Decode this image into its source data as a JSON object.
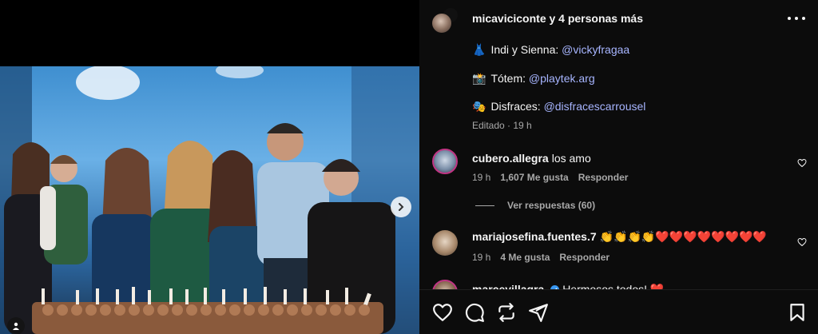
{
  "header": {
    "title": "micaviciconte y 4 personas más",
    "more_icon": "more-horizontal-icon"
  },
  "caption": {
    "lines": [
      {
        "emoji": "👗",
        "text": "Indi y Sienna: ",
        "mention": "@vickyfragaa"
      },
      {
        "emoji": "📸",
        "text": "Tótem: ",
        "mention": "@playtek.arg"
      },
      {
        "emoji": "🎭",
        "text": "Disfraces: ",
        "mention": "@disfracescarrousel"
      }
    ],
    "edited": "Editado · 19 h"
  },
  "comments": [
    {
      "username": "cubero.allegra",
      "text": "los amo",
      "time": "19 h",
      "likes": "1,607 Me gusta",
      "reply": "Responder"
    },
    {
      "username": "mariajosefina.fuentes.7",
      "text": "👏👏👏👏❤️❤️❤️❤️❤️❤️❤️❤️",
      "time": "19 h",
      "likes": "4 Me gusta",
      "reply": "Responder"
    },
    {
      "username": "marcevillagra",
      "text": "Hermosos todos! ❤️",
      "verified": true
    }
  ],
  "view_replies": "Ver respuestas (60)",
  "colors": {
    "panel_bg": "#0c0c0c",
    "mention": "#a7b5ff",
    "secondary_text": "#a8a8a8",
    "verified": "#3897f0"
  },
  "actions": {
    "like_icon": "heart-icon",
    "comment_icon": "comment-icon",
    "repost_icon": "repost-icon",
    "share_icon": "send-icon",
    "save_icon": "bookmark-icon"
  },
  "media": {
    "next_icon": "chevron-right-icon",
    "tag_icon": "user-tag-icon"
  }
}
